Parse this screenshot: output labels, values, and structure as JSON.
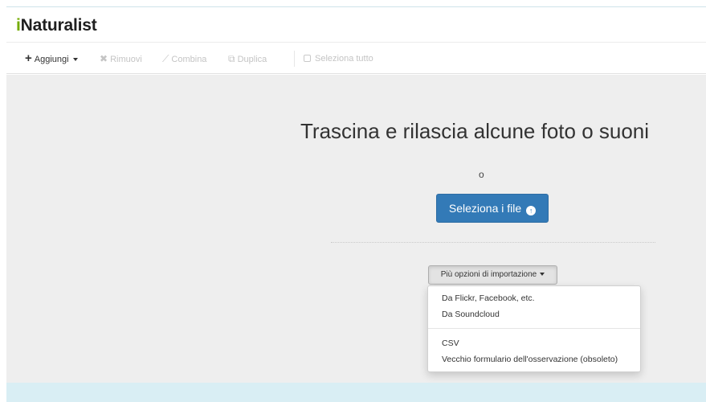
{
  "app": {
    "logo_first": "i",
    "logo_rest": "Naturalist",
    "brand_color": "#74ac00"
  },
  "toolbar": {
    "add": {
      "icon": "plus-icon",
      "label": "Aggiungi"
    },
    "remove": {
      "icon": "x-icon",
      "label": "Rimuovi"
    },
    "combine": {
      "icon": "wand-icon",
      "label": "Combina"
    },
    "duplicate": {
      "icon": "copy-icon",
      "label": "Duplica"
    },
    "select_all": {
      "label": "Seleziona tutto"
    }
  },
  "main": {
    "title": "Trascina e rilascia alcune foto o suoni",
    "or": "o",
    "select_button": {
      "label": "Seleziona i file",
      "icon": "upload-circle-icon",
      "color": "#337ab7"
    },
    "more_button": {
      "label": "Più opzioni di importazione"
    },
    "dropdown": {
      "group1": [
        "Da Flickr, Facebook, etc.",
        "Da Soundcloud"
      ],
      "group2": [
        "CSV",
        "Vecchio formulario dell'osservazione (obsoleto)"
      ]
    }
  }
}
